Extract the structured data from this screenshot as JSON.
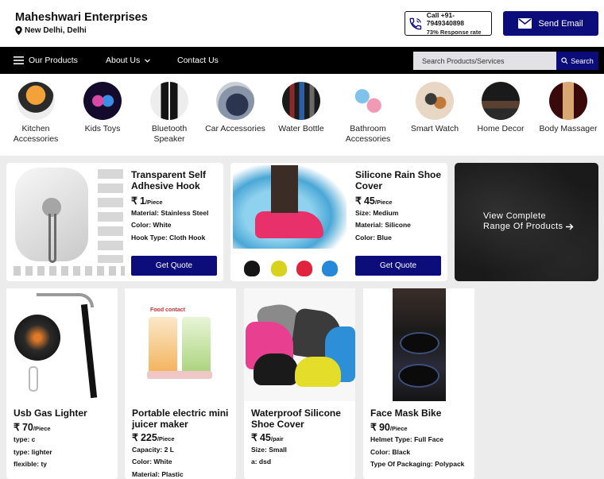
{
  "header": {
    "company_name": "Maheshwari Enterprises",
    "location": "New Delhi, Delhi",
    "call_label": "Call +91-7949340898",
    "response_rate": "73% Response rate",
    "email_label": "Send Email"
  },
  "nav": {
    "products": "Our Products",
    "about": "About Us",
    "contact": "Contact Us",
    "search_placeholder": "Search Products/Services",
    "search_button": "Search"
  },
  "categories": [
    {
      "label": "Kitchen Accessories",
      "icon": "kitchen-accessories-image"
    },
    {
      "label": "Kids Toys",
      "icon": "kids-toys-image"
    },
    {
      "label": "Bluetooth Speaker",
      "icon": "bluetooth-speaker-image"
    },
    {
      "label": "Car Accessories",
      "icon": "car-accessories-image"
    },
    {
      "label": "Water Bottle",
      "icon": "water-bottle-image"
    },
    {
      "label": "Bathroom Accessories",
      "icon": "bathroom-accessories-image"
    },
    {
      "label": "Smart Watch",
      "icon": "smart-watch-image"
    },
    {
      "label": "Home Decor",
      "icon": "home-decor-image"
    },
    {
      "label": "Body Massager",
      "icon": "body-massager-image"
    }
  ],
  "featured": [
    {
      "name": "Transparent Self Adhesive Hook",
      "currency": "₹",
      "price": "1",
      "unit": "/Piece",
      "specs": [
        "Material: Stainless Steel",
        "Color: White",
        "Hook Type: Cloth Hook"
      ],
      "button": "Get Quote"
    },
    {
      "name": "Silicone Rain Shoe Cover",
      "currency": "₹",
      "price": "45",
      "unit": "/Piece",
      "specs": [
        "Size: Medium",
        "Material: Silicone",
        "Color: Blue"
      ],
      "button": "Get Quote"
    }
  ],
  "view_complete": {
    "line1": "View Complete",
    "line2": "Range Of Products"
  },
  "products": [
    {
      "name": "Usb Gas Lighter",
      "currency": "₹",
      "price": "70",
      "unit": "/Piece",
      "specs": [
        "type: c",
        "type: lighter",
        "flexible: ty"
      ]
    },
    {
      "name": "Portable electric mini juicer maker",
      "image_caption": "Food contact",
      "currency": "₹",
      "price": "225",
      "unit": "/Piece",
      "specs": [
        "Capacity: 2 L",
        "Color: White",
        "Material: Plastic"
      ]
    },
    {
      "name": "Waterproof Silicone Shoe Cover",
      "currency": "₹",
      "price": "45",
      "unit": "/pair",
      "specs": [
        "Size: Small",
        "a: dsd"
      ]
    },
    {
      "name": "Face Mask Bike",
      "currency": "₹",
      "price": "90",
      "unit": "/Piece",
      "specs": [
        "Helmet Type: Full Face",
        "Color: Black",
        "Type Of Packaging: Polypack"
      ]
    }
  ],
  "colors": {
    "brand_navy": "#0c0c7a",
    "nav_black": "#000000",
    "page_bg": "#ececec"
  }
}
